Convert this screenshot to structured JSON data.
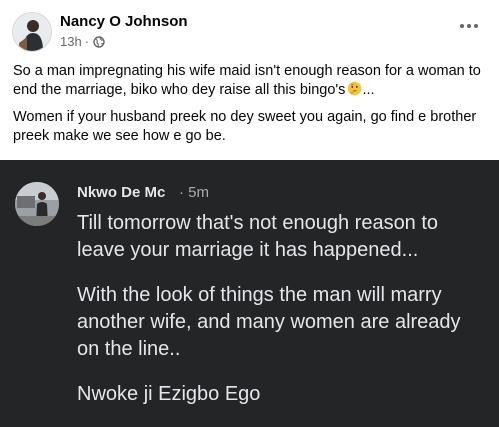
{
  "post": {
    "author": "Nancy O Johnson",
    "time": "13h",
    "separator": "·",
    "audience_icon": "globe-icon",
    "text_1": "So a man impregnating his wife maid isn't enough reason for a woman to end the marriage, biko who dey raise all this bingo's",
    "text_1_suffix": "...",
    "text_1_emoji": "thinking-face-icon",
    "text_2": "Women if your husband preek no dey sweet you again, go find e brother preek make we see how e go be."
  },
  "comment": {
    "author": "Nkwo De Mc",
    "time": "· 5m",
    "line_1": "Till tomorrow that's not enough reason to leave your marriage it has happened...",
    "line_2": "With the look of things the man will marry another wife, and many women are already on the line..",
    "line_3": "Nwoke ji Ezigbo Ego"
  },
  "colors": {
    "comment_bg": "#242526",
    "comment_text": "#e4e6eb",
    "meta_text": "#65676b"
  }
}
